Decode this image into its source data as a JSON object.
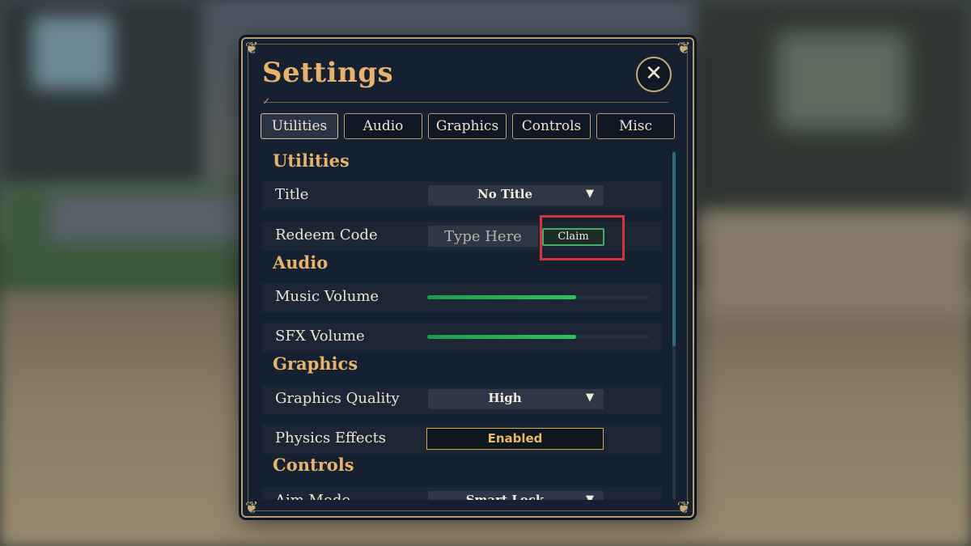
{
  "panel": {
    "title": "Settings",
    "close_glyph": "✕"
  },
  "tabs": [
    {
      "label": "Utilities",
      "active": true
    },
    {
      "label": "Audio",
      "active": false
    },
    {
      "label": "Graphics",
      "active": false
    },
    {
      "label": "Controls",
      "active": false
    },
    {
      "label": "Misc",
      "active": false
    }
  ],
  "sections": {
    "utilities": {
      "heading": "Utilities",
      "title_label": "Title",
      "title_value": "No Title",
      "redeem_label": "Redeem Code",
      "redeem_placeholder": "Type Here",
      "claim_label": "Claim"
    },
    "audio": {
      "heading": "Audio",
      "music_label": "Music Volume",
      "music_level_percent": 67,
      "sfx_label": "SFX Volume",
      "sfx_level_percent": 67
    },
    "graphics": {
      "heading": "Graphics",
      "quality_label": "Graphics Quality",
      "quality_value": "High",
      "physics_label": "Physics Effects",
      "physics_value": "Enabled"
    },
    "controls": {
      "heading": "Controls",
      "aim_label": "Aim Mode",
      "aim_value": "Smart Lock"
    }
  },
  "icons": {
    "dropdown": "chevron-down-icon",
    "close": "close-icon"
  },
  "colors": {
    "accent_gold": "#e7b36c",
    "slider_green": "#2bc45f",
    "claim_border": "#49a86a",
    "highlight_red": "#d8333a"
  }
}
